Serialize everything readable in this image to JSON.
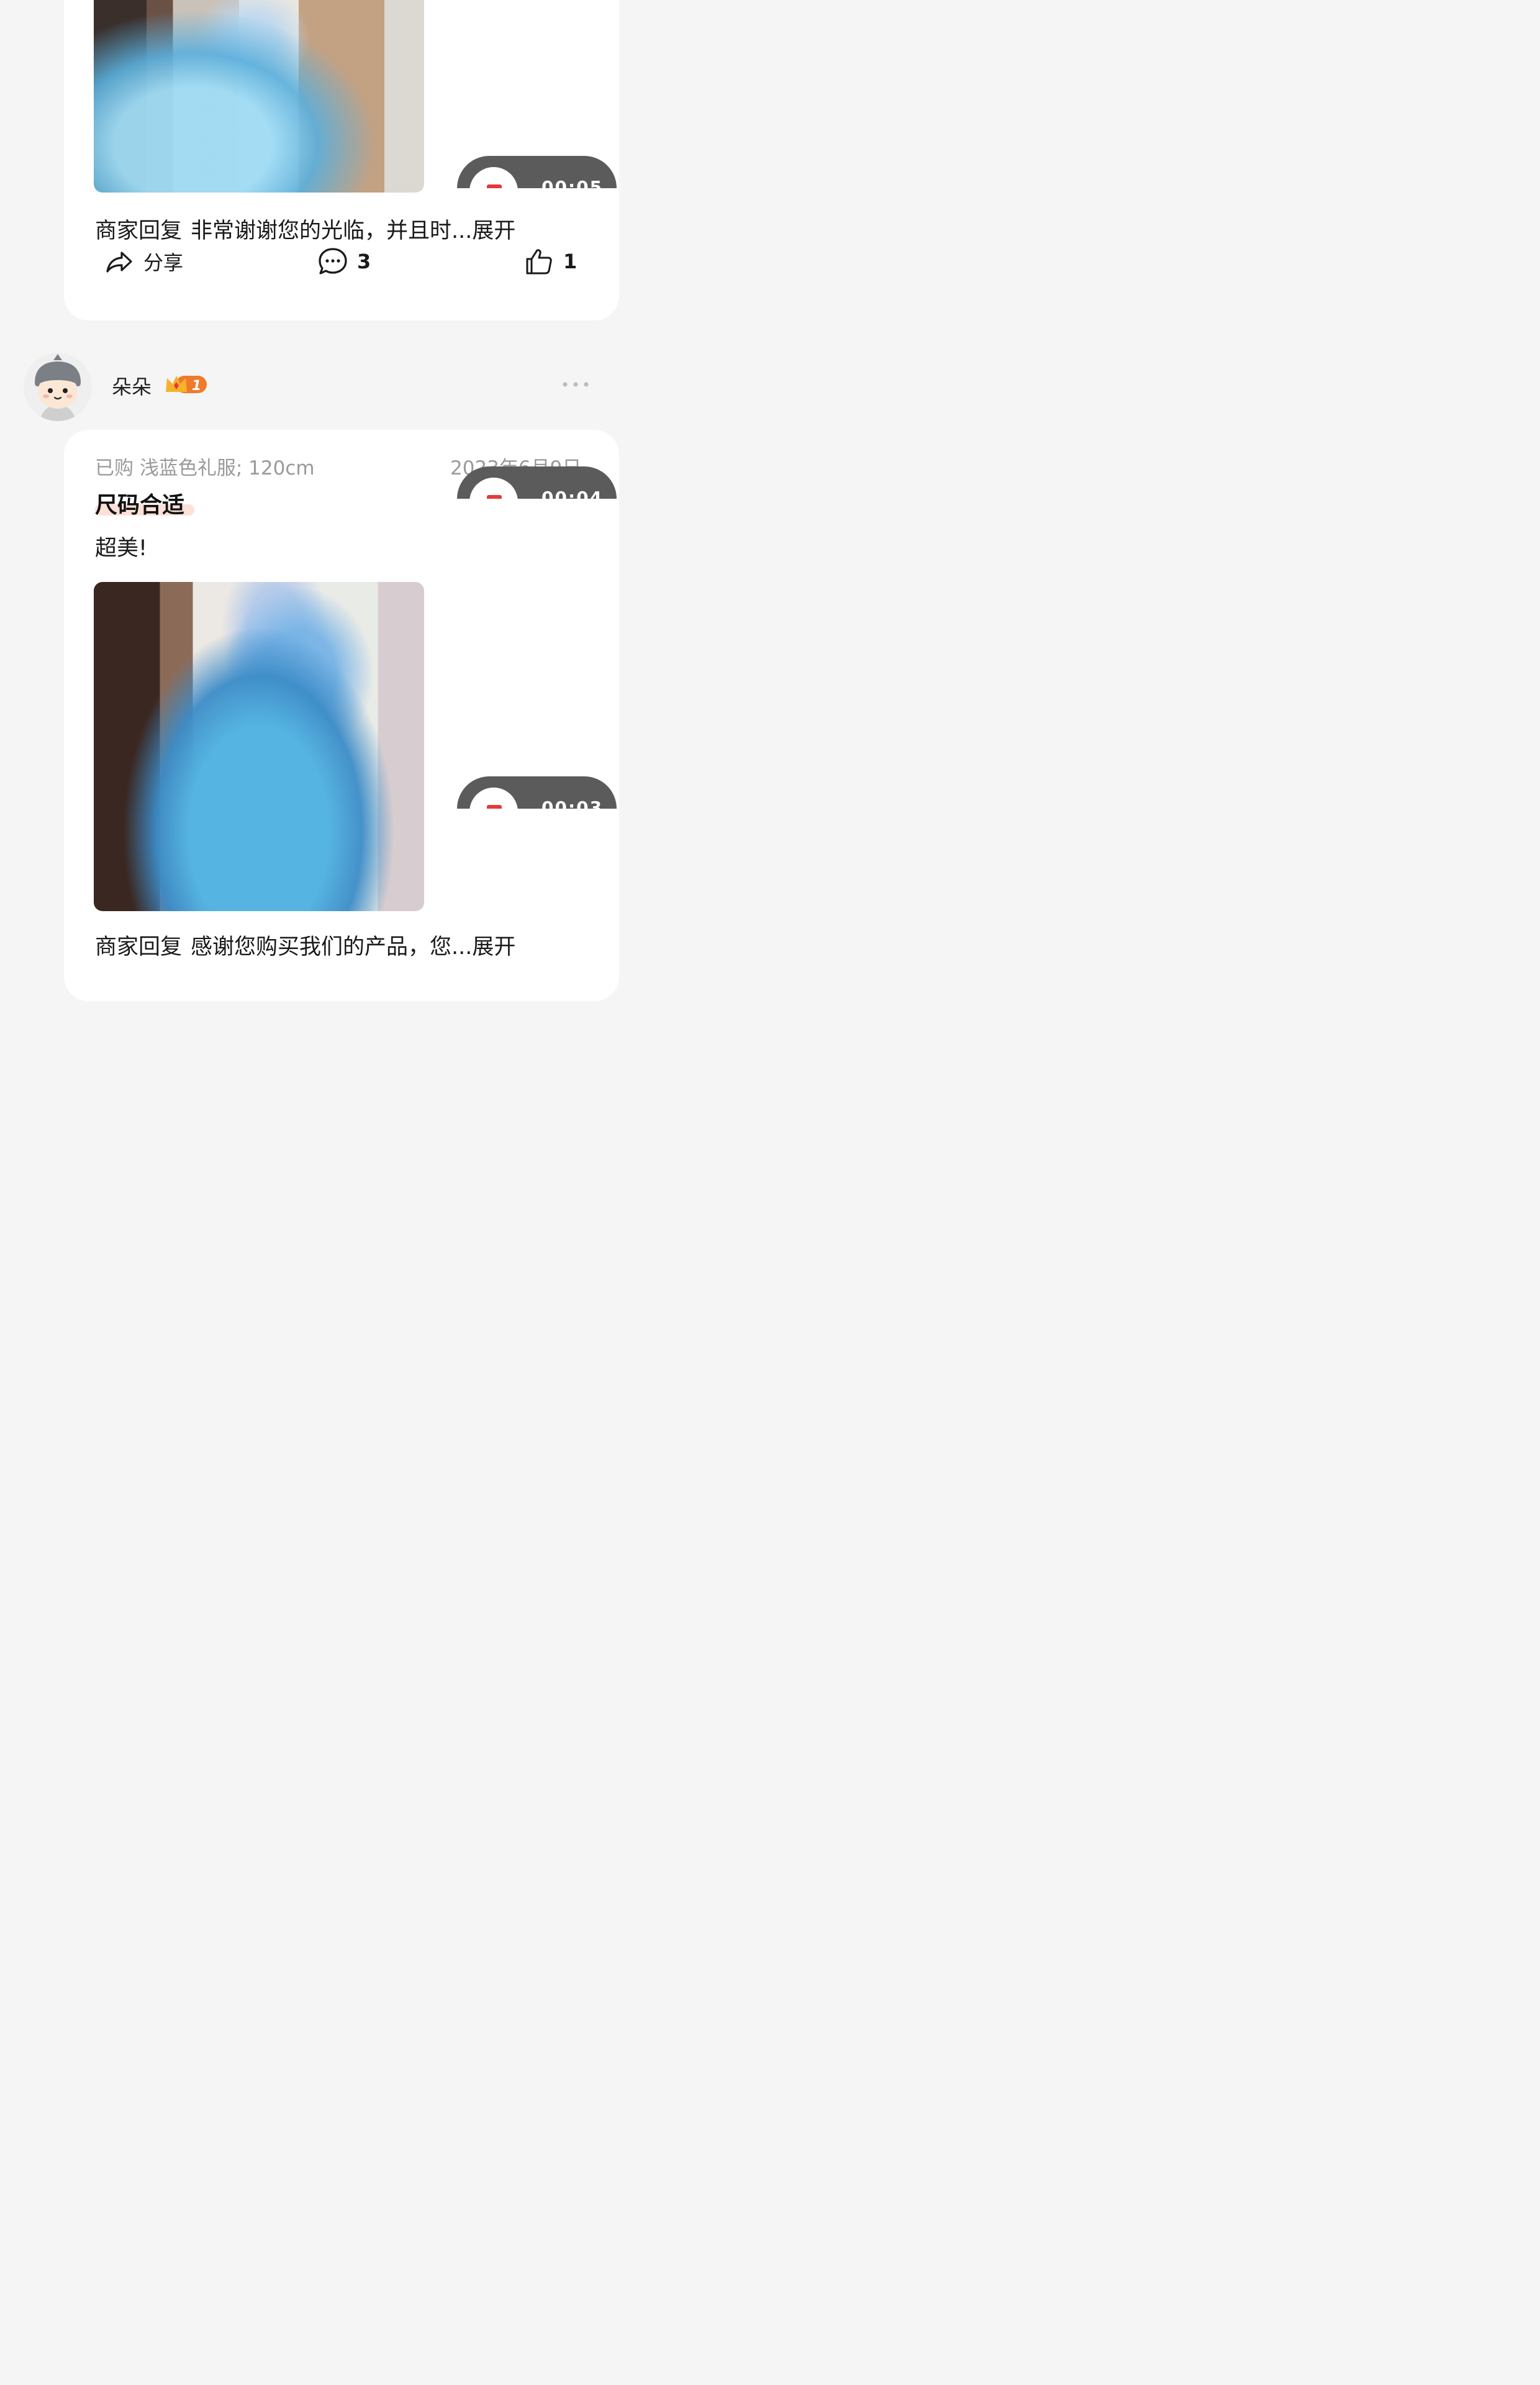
{
  "review_top": {
    "video_time": "00:05",
    "merchant_reply": {
      "label": "商家回复",
      "text": "非常谢谢您的光临，并且时...",
      "expand": "展开"
    },
    "actions": {
      "share_label": "分享",
      "comments_count": "3",
      "likes_count": "1"
    }
  },
  "review_user": {
    "name": "朵朵",
    "vip_level": "1",
    "purchase": "已购 浅蓝色礼服; 120cm",
    "date": "2023年6月9日",
    "tag": "尺码合适",
    "comment": "超美!",
    "video_time_1": "00:04",
    "video_time_2": "00:03",
    "merchant_reply": {
      "label": "商家回复",
      "text": "感谢您购买我们的产品，您...",
      "expand": "展开"
    }
  },
  "icons": [
    "share-icon",
    "comment-icon",
    "thumbs-up-icon",
    "avatar-icon",
    "vip-crown-icon",
    "more-icon",
    "video-play-icon"
  ],
  "colors": {
    "background": "#f5f5f5",
    "card": "#ffffff",
    "video_badge": "#5b5b5b",
    "video_mark": "#e4393c",
    "meta_text": "#9a9a9a",
    "tag_highlight": "#fde0d8",
    "vip_gold": "#f5b22a",
    "vip_orange": "#f07a2b"
  }
}
